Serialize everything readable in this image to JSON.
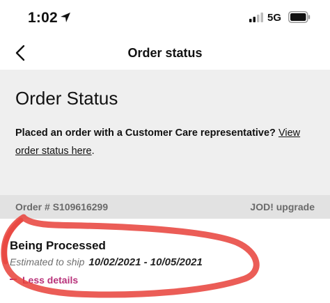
{
  "status_bar": {
    "time": "1:02",
    "network": "5G",
    "icons": [
      "location-arrow-icon",
      "signal-bars-icon",
      "battery-icon"
    ]
  },
  "nav": {
    "title": "Order status",
    "back_icon": "chevron-left-icon"
  },
  "panel": {
    "title": "Order Status",
    "prompt": "Placed an order with a Customer Care representative?",
    "link_text": "View order status here",
    "link_suffix": "."
  },
  "order": {
    "number_label": "Order # S109616299",
    "upgrade_label": "JOD! upgrade",
    "status": "Being Processed",
    "ship_label": "Estimated to ship",
    "ship_dates": "10/02/2021 - 10/05/2021",
    "less_details": "Less details"
  },
  "colors": {
    "panel_bg": "#efefef",
    "order_row_bg": "#e2e2e2",
    "accent": "#b8327a",
    "annotation": "#e8413a"
  }
}
